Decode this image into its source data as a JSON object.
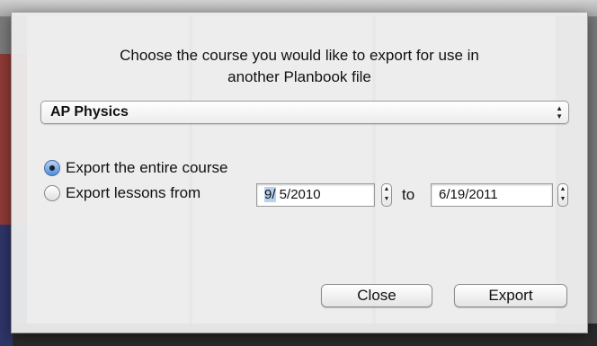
{
  "dialog": {
    "prompt_line1": "Choose the course you would like to export for use in",
    "prompt_line2": "another Planbook file",
    "course_popup": {
      "selected": "AP Physics",
      "icon": "updown-arrows-icon"
    },
    "options": [
      {
        "label": "Export the entire course",
        "selected": true
      },
      {
        "label": "Export lessons from",
        "selected": false
      }
    ],
    "date_from": {
      "month": "9/",
      "rest": " 5/2010"
    },
    "to_label": "to",
    "date_to": "6/19/2011",
    "buttons": {
      "close": "Close",
      "export": "Export"
    }
  },
  "colors": {
    "sheet_bg": "#ececec",
    "radio_selected": "#4f8de1",
    "text_selection": "#b7d2f1",
    "bg_red": "#8e3a35",
    "bg_blue": "#2e3568"
  }
}
